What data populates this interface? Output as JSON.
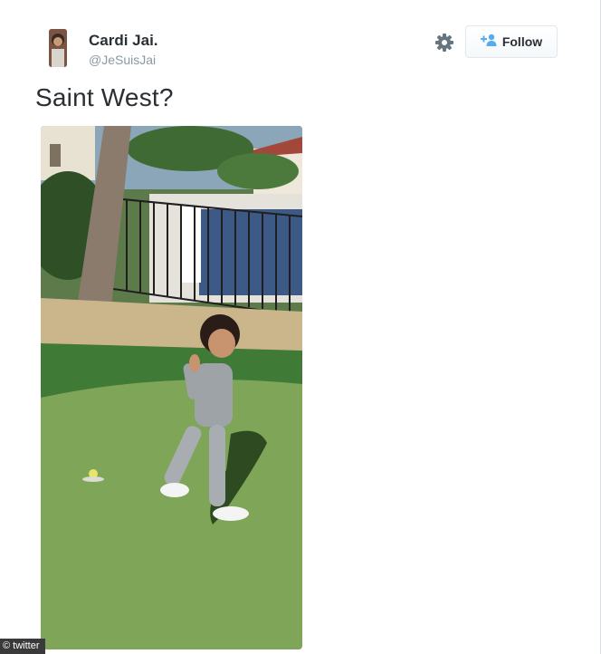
{
  "tweet": {
    "author_name": "Cardi Jai.",
    "author_handle": "@JeSuisJai",
    "text": "Saint West?",
    "follow_label": "Follow",
    "settings_icon": "gear-icon",
    "follow_icon": "add-user-icon"
  },
  "watermark": {
    "text": "© twitter"
  },
  "colors": {
    "name": "#292f33",
    "handle": "#8899a6",
    "follow_icon": "#55acee",
    "gear": "#66757f"
  }
}
